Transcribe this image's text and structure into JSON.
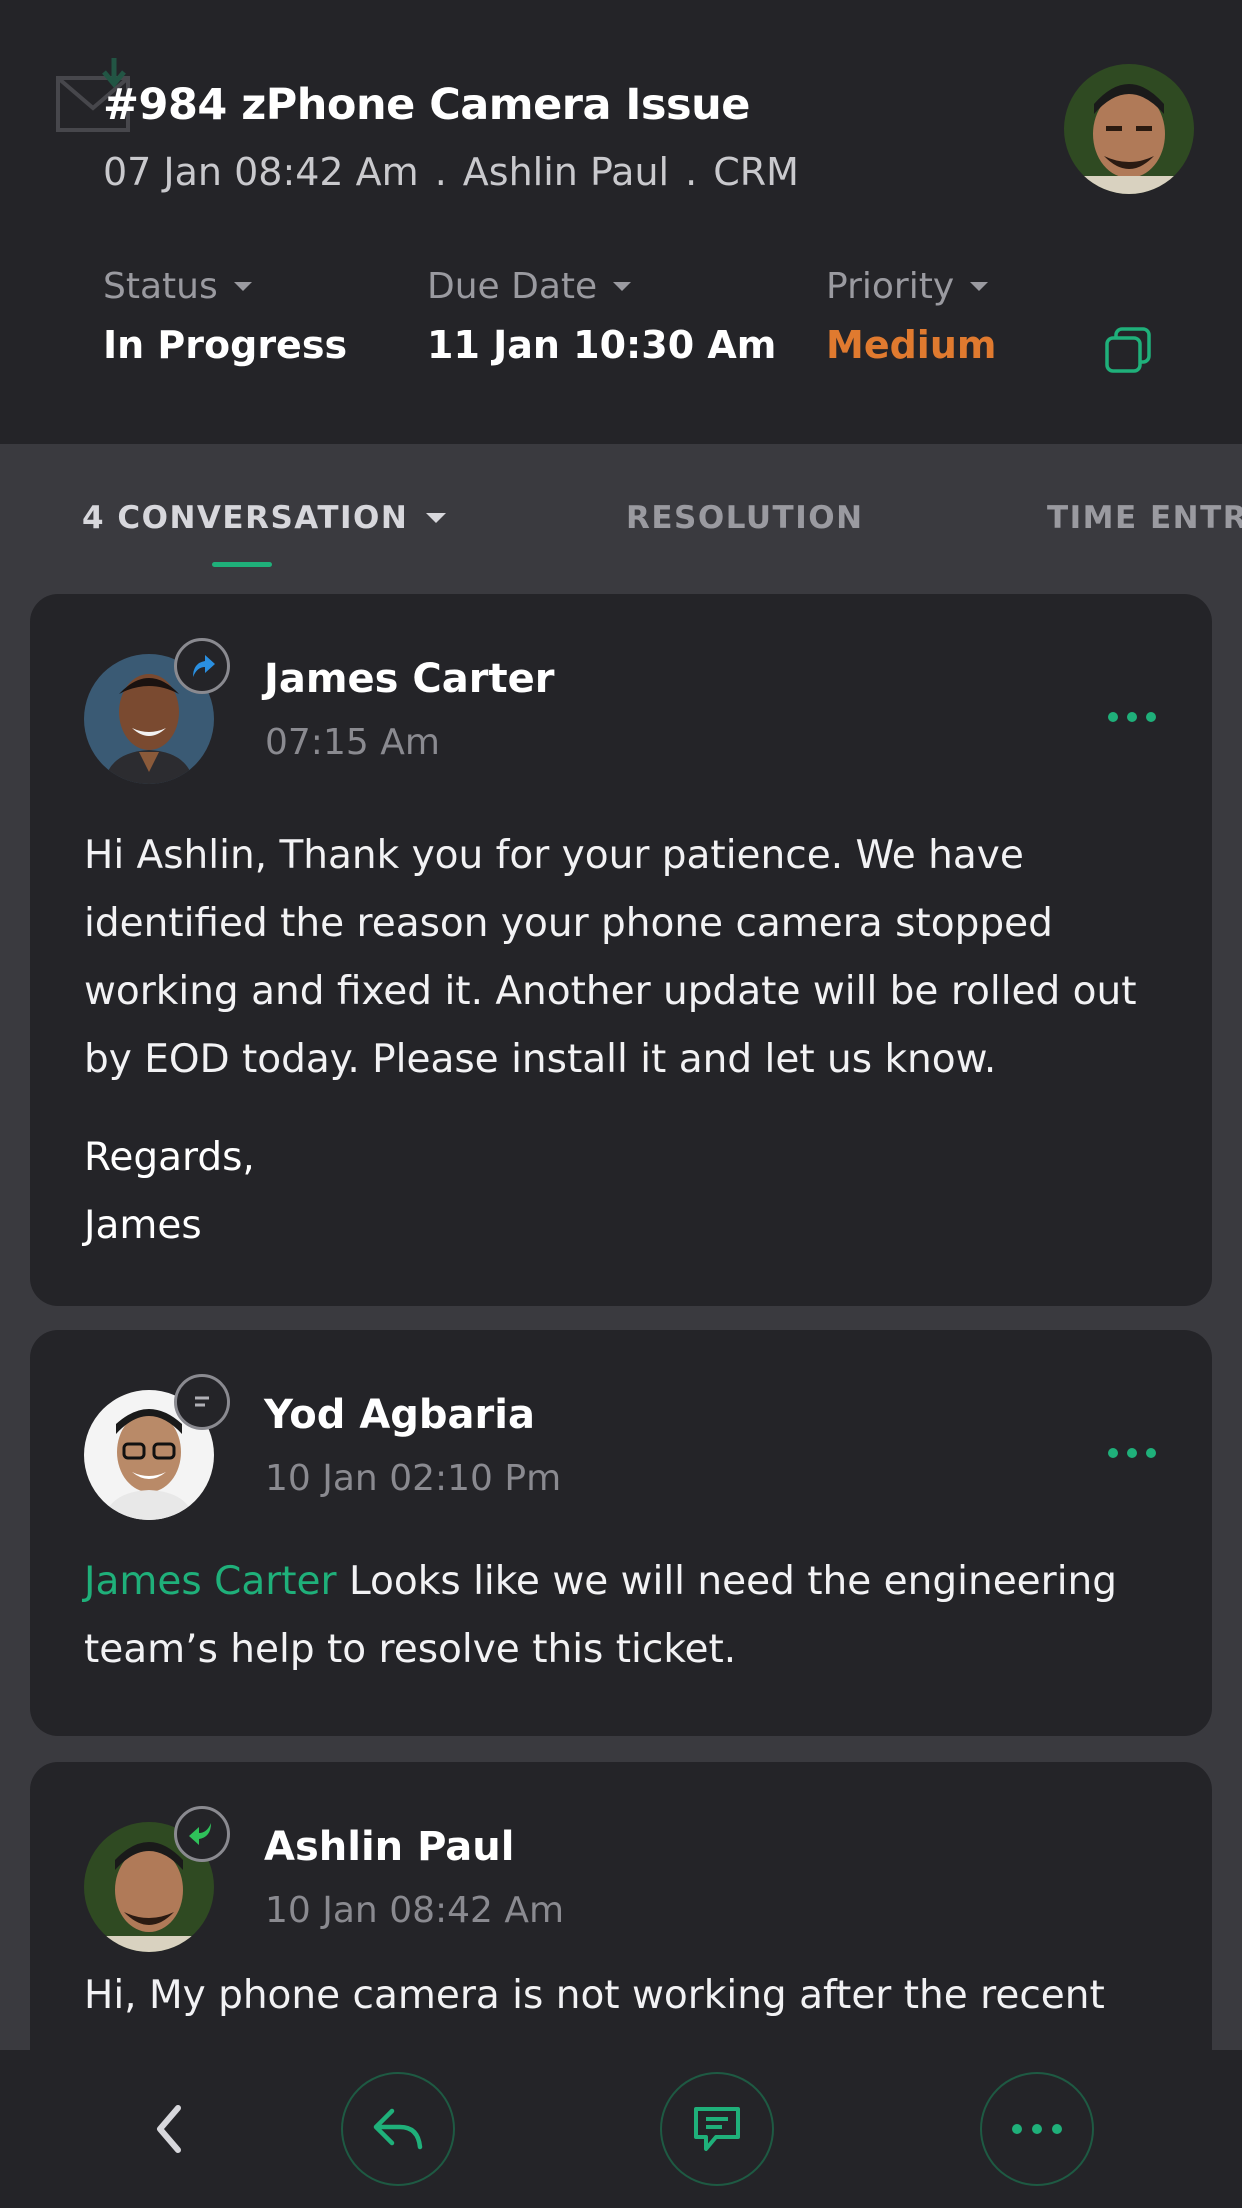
{
  "header": {
    "ticket_title": "#984 zPhone Camera Issue",
    "date": "07 Jan 08:42 Am",
    "contact": "Ashlin Paul",
    "department": "CRM",
    "separator": ".",
    "status_label": "Status",
    "status_value": "In Progress",
    "due_label": "Due Date",
    "due_value": "11 Jan 10:30 Am",
    "priority_label": "Priority",
    "priority_value": "Medium"
  },
  "tabs": {
    "conversation": "4 CONVERSATION",
    "resolution": "RESOLUTION",
    "time_entry": "TIME ENTRY"
  },
  "threads": [
    {
      "author": "James Carter",
      "time": "07:15 Am",
      "badge_icon": "outgoing-reply-icon",
      "body": "Hi Ashlin, Thank you for your patience. We have identified the reason your phone camera stopped working and fixed it. Another update will be rolled out by EOD today. Please install it and let us know.",
      "sign_line1": "Regards,",
      "sign_line2": "James"
    },
    {
      "author": "Yod Agbaria",
      "time": "10 Jan 02:10 Pm",
      "badge_icon": "comment-icon",
      "mention": "James Carter",
      "body": "Looks like we will need the engineering team’s help to resolve this ticket."
    },
    {
      "author": "Ashlin Paul",
      "time": "10 Jan 08:42 Am",
      "badge_icon": "incoming-message-icon",
      "body": "Hi, My phone camera is not working after the recent"
    }
  ],
  "colors": {
    "accent": "#1fb07a",
    "priority_medium": "#e07a2f",
    "background": "#3a3a3f",
    "card": "#242428"
  },
  "bottombar": {
    "icons": [
      "back-icon",
      "reply-icon",
      "comment-icon",
      "more-icon"
    ]
  }
}
